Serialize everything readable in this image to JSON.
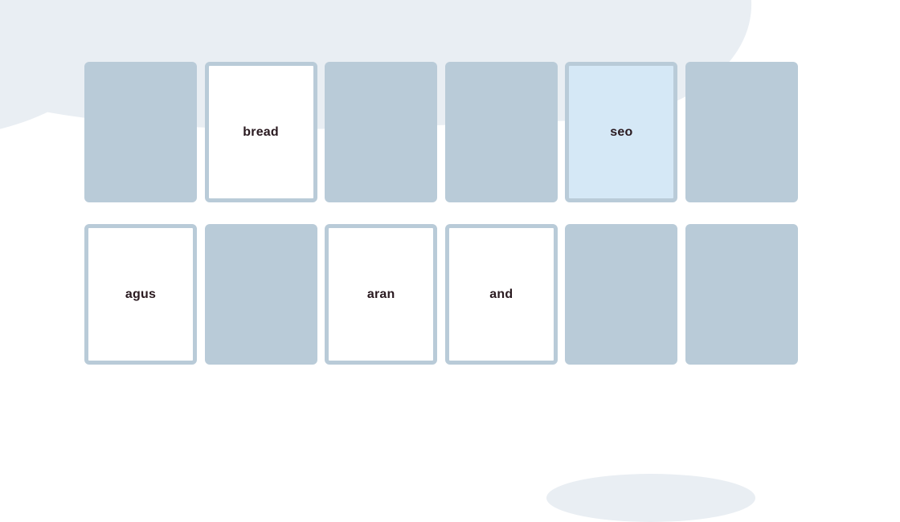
{
  "game": {
    "colors": {
      "card_back": "#b9cbd8",
      "card_face": "#ffffff",
      "card_selected": "#d5e8f6",
      "text": "#2a1a20",
      "background_shape": "#e9eef3"
    },
    "cards": [
      {
        "state": "face-down",
        "word": ""
      },
      {
        "state": "face-up",
        "word": "bread"
      },
      {
        "state": "face-down",
        "word": ""
      },
      {
        "state": "face-down",
        "word": ""
      },
      {
        "state": "selected",
        "word": "seo"
      },
      {
        "state": "face-down",
        "word": ""
      },
      {
        "state": "face-up",
        "word": "agus"
      },
      {
        "state": "face-down",
        "word": ""
      },
      {
        "state": "face-up",
        "word": "aran"
      },
      {
        "state": "face-up",
        "word": "and"
      },
      {
        "state": "face-down",
        "word": ""
      },
      {
        "state": "face-down",
        "word": ""
      }
    ]
  }
}
